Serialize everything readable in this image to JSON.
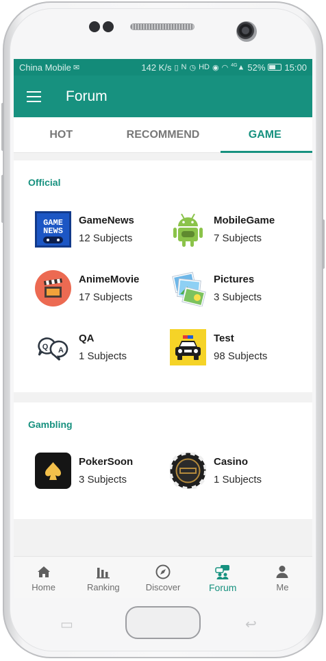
{
  "statusbar": {
    "carrier": "China Mobile",
    "speed": "142 K/s",
    "signal": "4G",
    "battery": "52%",
    "time": "15:00"
  },
  "appbar": {
    "title": "Forum"
  },
  "tabs": [
    {
      "label": "HOT",
      "active": false
    },
    {
      "label": "RECOMMEND",
      "active": false
    },
    {
      "label": "GAME",
      "active": true
    }
  ],
  "sections": [
    {
      "title": "Official",
      "items": [
        {
          "name": "GameNews",
          "count": "12 Subjects",
          "icon": "game-news-icon"
        },
        {
          "name": "MobileGame",
          "count": "7 Subjects",
          "icon": "android-icon"
        },
        {
          "name": "AnimeMovie",
          "count": "17 Subjects",
          "icon": "clapperboard-icon"
        },
        {
          "name": "Pictures",
          "count": "3 Subjects",
          "icon": "pictures-icon"
        },
        {
          "name": "QA",
          "count": "1 Subjects",
          "icon": "qa-bubbles-icon",
          "icon_text_q": "Q",
          "icon_text_a": "A"
        },
        {
          "name": "Test",
          "count": "98 Subjects",
          "icon": "police-car-icon"
        }
      ]
    },
    {
      "title": "Gambling",
      "items": [
        {
          "name": "PokerSoon",
          "count": "3 Subjects",
          "icon": "spade-icon"
        },
        {
          "name": "Casino",
          "count": "1 Subjects",
          "icon": "casino-chip-icon"
        }
      ]
    }
  ],
  "bottomnav": [
    {
      "label": "Home",
      "icon": "home-icon",
      "active": false
    },
    {
      "label": "Ranking",
      "icon": "ranking-icon",
      "active": false
    },
    {
      "label": "Discover",
      "icon": "compass-icon",
      "active": false
    },
    {
      "label": "Forum",
      "icon": "forum-icon",
      "active": true
    },
    {
      "label": "Me",
      "icon": "person-icon",
      "active": false
    }
  ],
  "colors": {
    "primary": "#17917f",
    "statusbar": "#138b79",
    "background": "#f2f2f2"
  }
}
